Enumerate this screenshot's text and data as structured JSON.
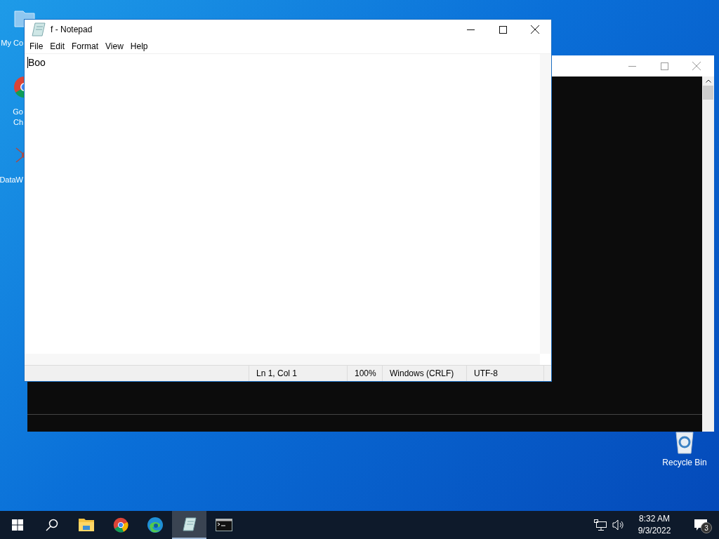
{
  "desktop_icons": [
    {
      "kind": "computer",
      "lines": [
        "My Co"
      ]
    },
    {
      "kind": "chrome",
      "lines": [
        "Go",
        "Ch"
      ]
    },
    {
      "kind": "app",
      "lines": [
        "DataW"
      ]
    },
    {
      "kind": "recycle",
      "lines": [
        "Recycle Bin"
      ]
    }
  ],
  "notepad": {
    "title": "f - Notepad",
    "menu": [
      "File",
      "Edit",
      "Format",
      "View",
      "Help"
    ],
    "text": "Boo",
    "status": [
      "Ln 1, Col 1",
      "100%",
      "Windows (CRLF)",
      "UTF-8"
    ]
  },
  "taskbar": {
    "items": [
      {
        "kind": "start",
        "selected": false
      },
      {
        "kind": "search",
        "selected": false
      },
      {
        "kind": "explorer",
        "selected": false
      },
      {
        "kind": "chrome",
        "selected": false
      },
      {
        "kind": "edge",
        "selected": false
      },
      {
        "kind": "notepad",
        "selected": true
      },
      {
        "kind": "console",
        "selected": false
      }
    ],
    "time": "8:32 AM",
    "date": "9/3/2022",
    "notifications": "3"
  }
}
